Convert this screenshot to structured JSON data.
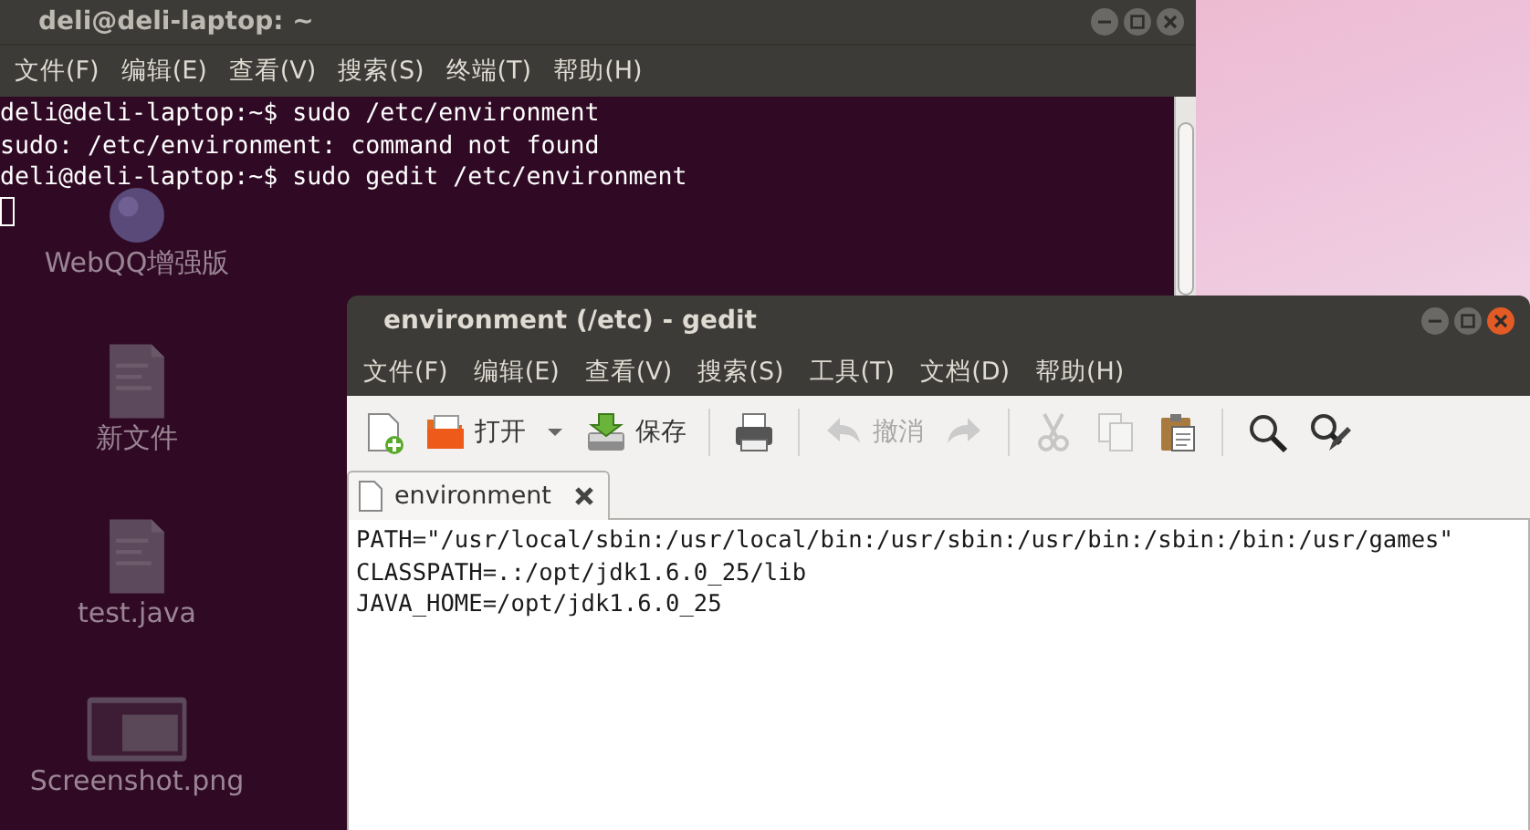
{
  "terminal": {
    "title": "deli@deli-laptop: ~",
    "menu": [
      "文件(F)",
      "编辑(E)",
      "查看(V)",
      "搜索(S)",
      "终端(T)",
      "帮助(H)"
    ],
    "lines": [
      "deli@deli-laptop:~$ sudo /etc/environment",
      "sudo: /etc/environment: command not found",
      "deli@deli-laptop:~$ sudo gedit /etc/environment"
    ],
    "desktop_icons": [
      {
        "kind": "globe",
        "label": "WebQQ增强版"
      },
      {
        "kind": "document",
        "label": "新文件"
      },
      {
        "kind": "document",
        "label": "test.java"
      },
      {
        "kind": "image",
        "label": "Screenshot.png"
      }
    ]
  },
  "gedit": {
    "title": "environment (/etc) - gedit",
    "menu": [
      "文件(F)",
      "编辑(E)",
      "查看(V)",
      "搜索(S)",
      "工具(T)",
      "文档(D)",
      "帮助(H)"
    ],
    "toolbar": [
      {
        "kind": "new",
        "disabled": false
      },
      {
        "kind": "open",
        "label": "打开",
        "disabled": false
      },
      {
        "kind": "dropdown",
        "disabled": false
      },
      {
        "kind": "save",
        "label": "保存",
        "disabled": false
      },
      {
        "kind": "separator"
      },
      {
        "kind": "print",
        "disabled": false
      },
      {
        "kind": "separator"
      },
      {
        "kind": "undo",
        "label": "撤消",
        "disabled": true
      },
      {
        "kind": "redo",
        "disabled": true
      },
      {
        "kind": "separator"
      },
      {
        "kind": "cut",
        "disabled": true
      },
      {
        "kind": "copy",
        "disabled": true
      },
      {
        "kind": "paste",
        "disabled": false
      },
      {
        "kind": "separator"
      },
      {
        "kind": "find",
        "disabled": false
      },
      {
        "kind": "replace",
        "disabled": false
      }
    ],
    "tabs": [
      {
        "label": "environment",
        "selected": true
      }
    ],
    "lines": [
      "PATH=\"/usr/local/sbin:/usr/local/bin:/usr/sbin:/usr/bin:/sbin:/bin:/usr/games\"",
      "CLASSPATH=.:/opt/jdk1.6.0_25/lib",
      "JAVA_HOME=/opt/jdk1.6.0_25"
    ]
  }
}
